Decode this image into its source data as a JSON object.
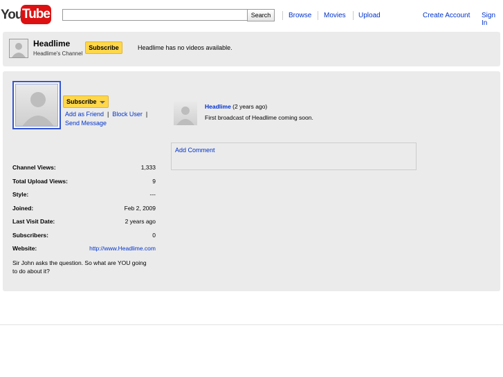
{
  "header": {
    "logo_you": "You",
    "logo_tube": "Tube",
    "search_placeholder": "",
    "search_button": "Search",
    "nav": [
      "Browse",
      "Movies",
      "Upload"
    ],
    "create_account": "Create Account",
    "sign_in": "Sign In"
  },
  "channel_bar": {
    "name": "Headlime",
    "subtitle": "Headlime's Channel",
    "subscribe": "Subscribe",
    "no_videos": "Headlime has no videos available."
  },
  "profile": {
    "subscribe": "Subscribe",
    "add_friend": "Add as Friend",
    "block_user": "Block User",
    "send_message": "Send Message",
    "stats": [
      {
        "label": "Channel Views:",
        "value": "1,333"
      },
      {
        "label": "Total Upload Views:",
        "value": "9"
      },
      {
        "label": "Style:",
        "value": "---"
      },
      {
        "label": "Joined:",
        "value": "Feb 2, 2009"
      },
      {
        "label": "Last Visit Date:",
        "value": "2 years ago"
      },
      {
        "label": "Subscribers:",
        "value": "0"
      },
      {
        "label": "Website:",
        "value": "http://www.Headlime.com"
      }
    ],
    "description": "Sir John asks the question. So what are YOU going to do about it?"
  },
  "comments": {
    "author": "Headlime",
    "time": "(2 years ago)",
    "text": "First broadcast of Headlime coming soon.",
    "add_comment": "Add Comment"
  },
  "colors": {
    "link": "#0033cc",
    "panel_bg": "#ebebeb",
    "subscribe_bg": "#ffd74a",
    "logo_red": "#dd1111"
  }
}
